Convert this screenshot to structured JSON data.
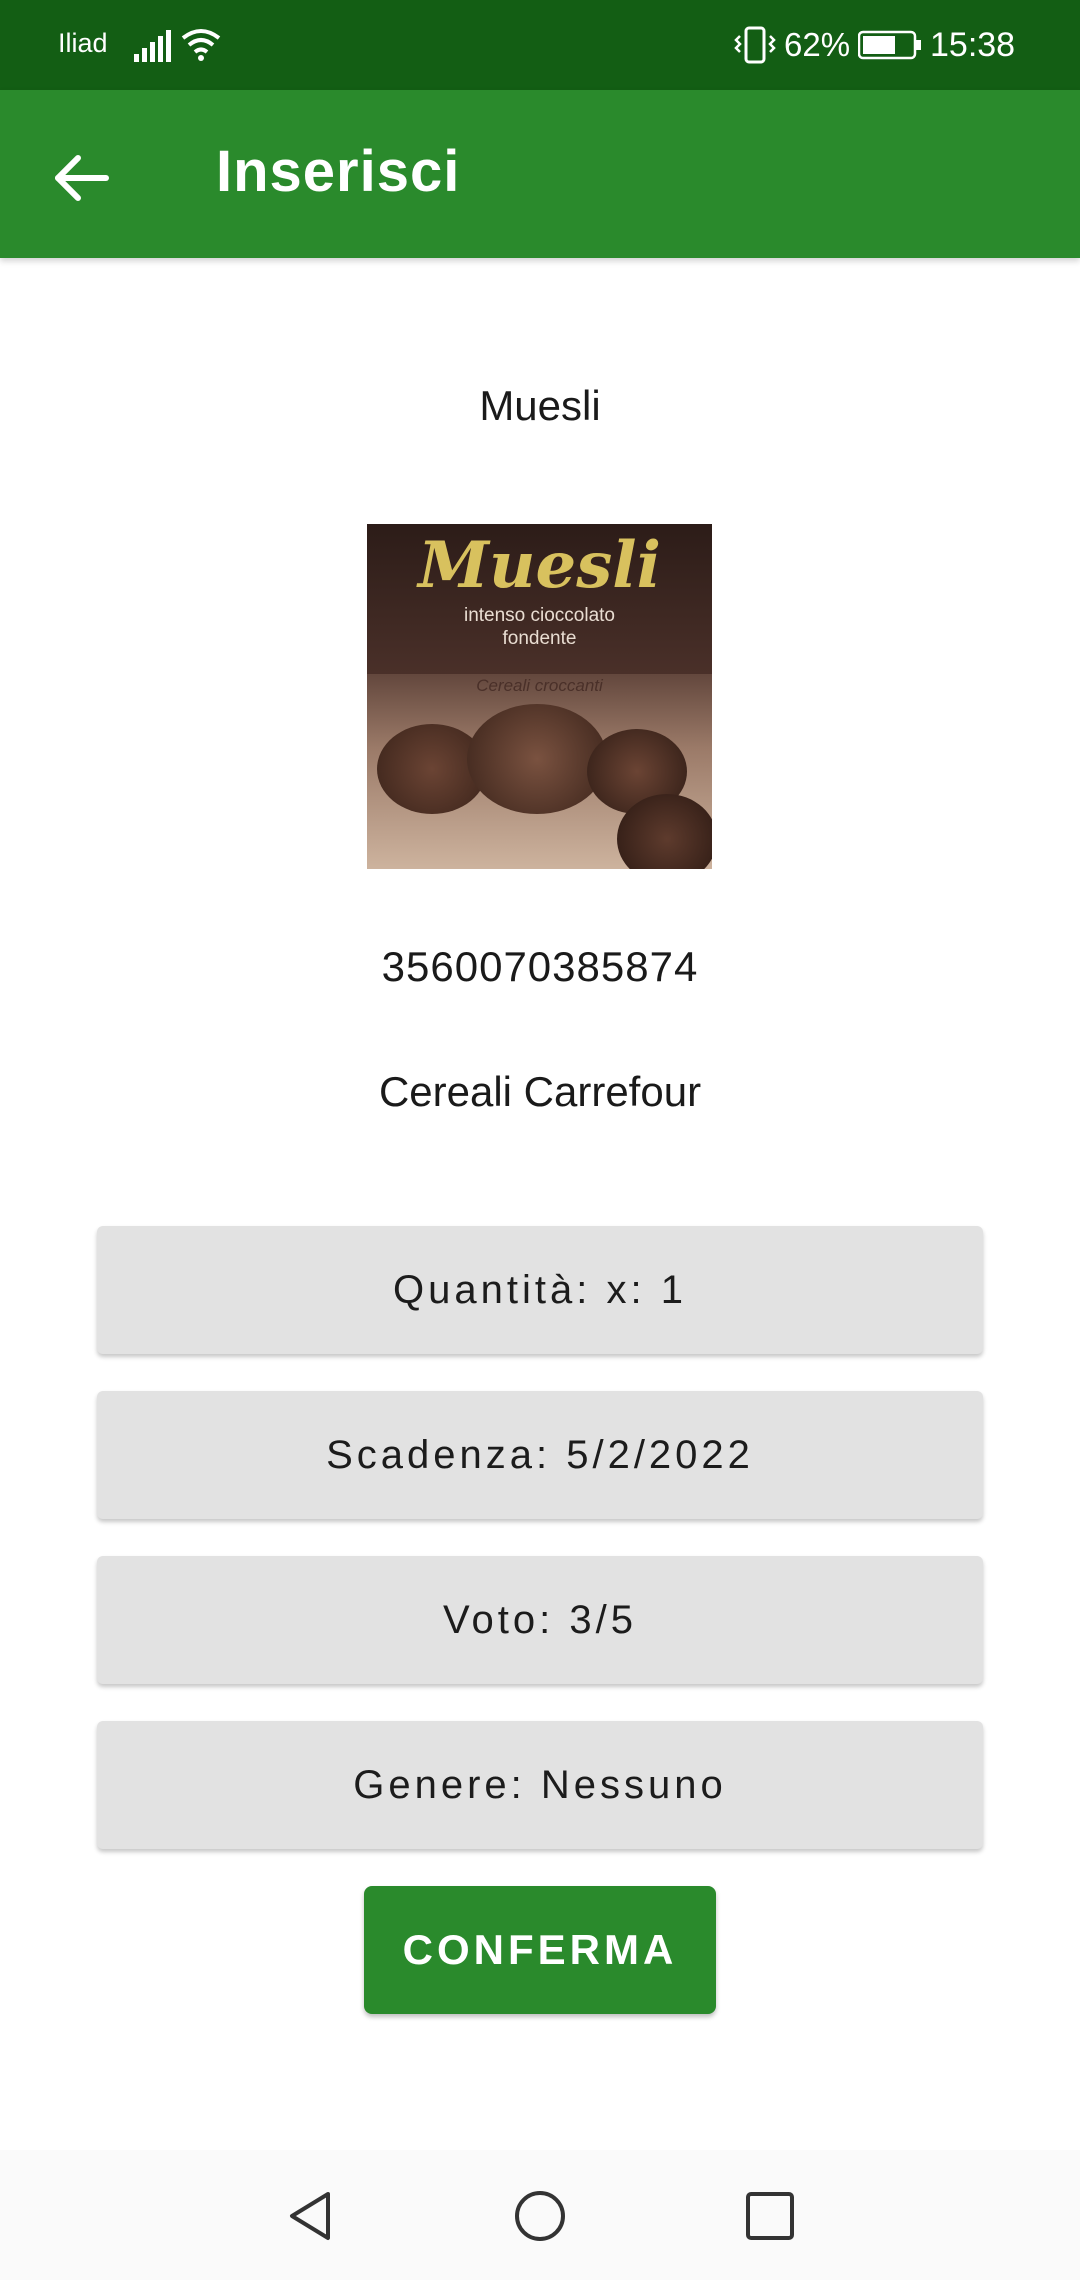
{
  "status_bar": {
    "carrier": "Iliad",
    "battery_percent": "62%",
    "time": "15:38"
  },
  "app_bar": {
    "title": "Inserisci",
    "back_icon": "arrow-left-icon"
  },
  "product": {
    "name": "Muesli",
    "image": {
      "title": "Muesli",
      "subtitle_line1": "intenso cioccolato",
      "subtitle_line2": "fondente",
      "tagline": "Cereali croccanti"
    },
    "barcode": "3560070385874",
    "category": "Cereali Carrefour"
  },
  "fields": {
    "quantity": "Quantità: x: 1",
    "expiry": "Scadenza: 5/2/2022",
    "rating": "Voto: 3/5",
    "genre": "Genere: Nessuno"
  },
  "confirm_label": "CONFERMA",
  "nav_bar": {
    "icons": [
      "nav-back-icon",
      "nav-home-icon",
      "nav-recents-icon"
    ]
  },
  "colors": {
    "status_bar": "#135e14",
    "app_bar": "#2a8a2c",
    "field_background": "#e2e2e2",
    "confirm_button": "#2a8a2c"
  }
}
